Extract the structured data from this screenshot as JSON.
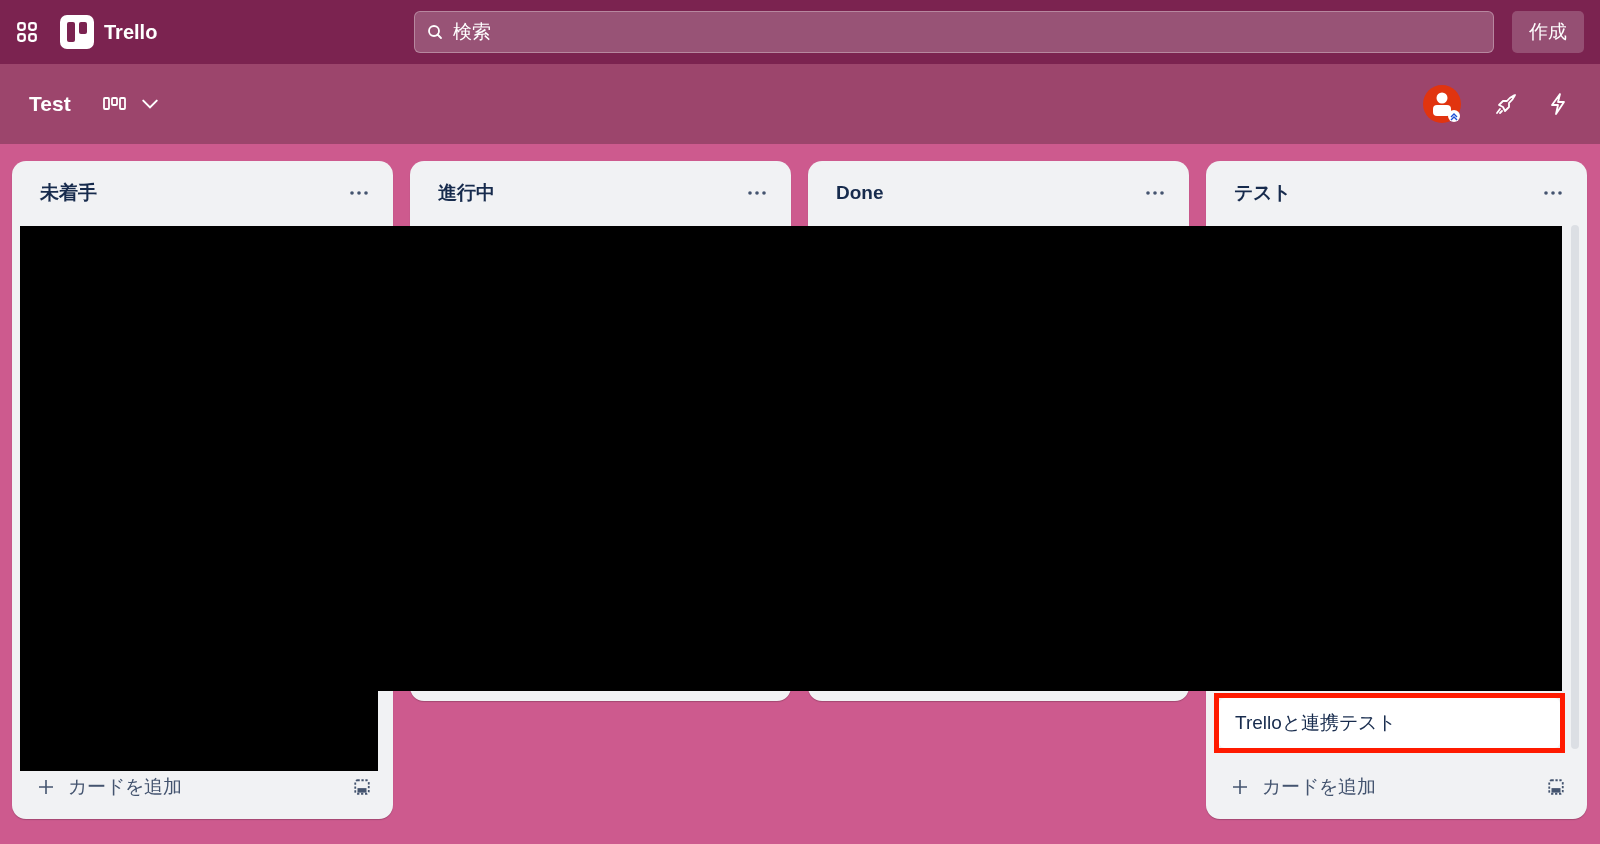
{
  "topbar": {
    "app_name": "Trello",
    "search": {
      "placeholder": "検索"
    },
    "create_button": "作成"
  },
  "board": {
    "title": "Test"
  },
  "lists": [
    {
      "title": "未着手",
      "add_card": "カードを追加"
    },
    {
      "title": "進行中"
    },
    {
      "title": "Done"
    },
    {
      "title": "テスト",
      "cards": [
        {
          "title": "Trelloと連携テスト",
          "highlighted": true
        }
      ],
      "add_card": "カードを追加"
    }
  ]
}
